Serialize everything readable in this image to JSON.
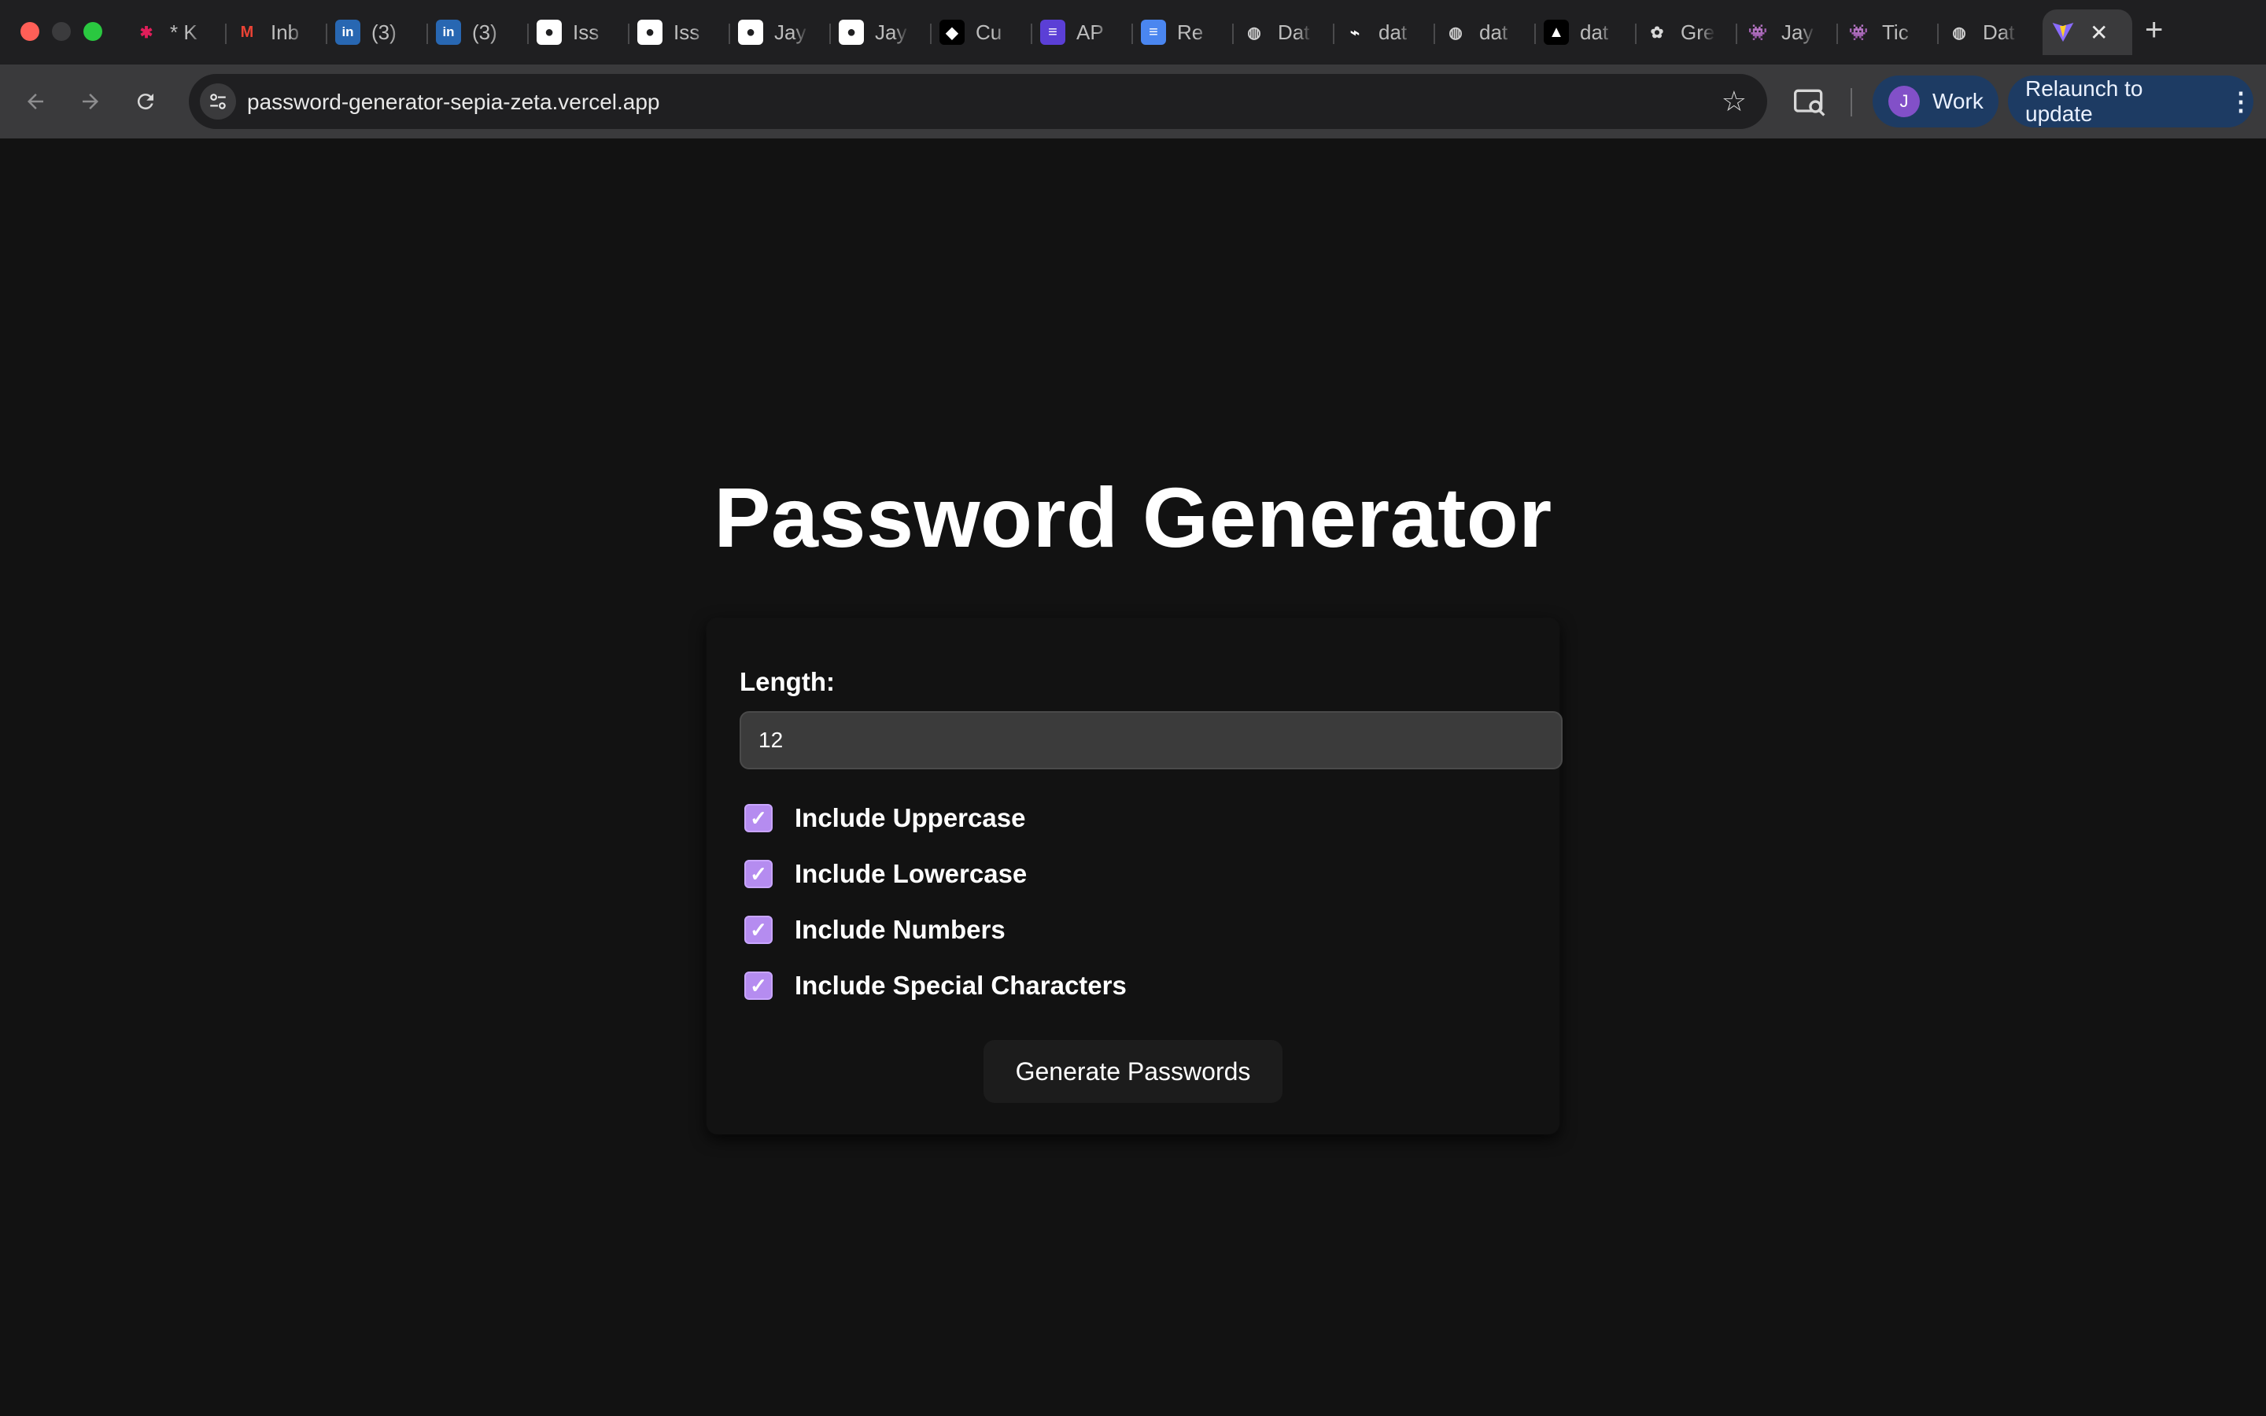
{
  "browser": {
    "tabs": [
      {
        "title": "* K",
        "icon": "slack-icon"
      },
      {
        "title": "Inb",
        "icon": "gmail-icon"
      },
      {
        "title": "(3)",
        "icon": "linkedin-icon"
      },
      {
        "title": "(3)",
        "icon": "linkedin-icon"
      },
      {
        "title": "Iss",
        "icon": "github-icon"
      },
      {
        "title": "Iss",
        "icon": "github-icon"
      },
      {
        "title": "Jay",
        "icon": "github-icon"
      },
      {
        "title": "Jay",
        "icon": "github-icon"
      },
      {
        "title": "Cu",
        "icon": "cursor-icon"
      },
      {
        "title": "AP",
        "icon": "list-icon"
      },
      {
        "title": "Re",
        "icon": "docs-icon"
      },
      {
        "title": "Dat",
        "icon": "globe-icon"
      },
      {
        "title": "dat",
        "icon": "link-icon"
      },
      {
        "title": "dat",
        "icon": "globe-icon"
      },
      {
        "title": "dat",
        "icon": "vercel-icon"
      },
      {
        "title": "Gre",
        "icon": "openai-icon"
      },
      {
        "title": "Jay",
        "icon": "alien-icon"
      },
      {
        "title": "Tic",
        "icon": "alien-icon"
      },
      {
        "title": "Dat",
        "icon": "globe-icon"
      }
    ],
    "active_tab": {
      "icon": "vite-icon",
      "close": "✕"
    },
    "new_tab": "+",
    "url": "password-generator-sepia-zeta.vercel.app",
    "profile": {
      "initial": "J",
      "name": "Work"
    },
    "relaunch_label": "Relaunch to update",
    "colors": {
      "chip_bg": "#1d3b63",
      "avatar": "#8250c8"
    }
  },
  "app": {
    "title": "Password Generator",
    "length_label": "Length:",
    "length_value": "12",
    "options": [
      {
        "label": "Include Uppercase",
        "checked": true
      },
      {
        "label": "Include Lowercase",
        "checked": true
      },
      {
        "label": "Include Numbers",
        "checked": true
      },
      {
        "label": "Include Special Characters",
        "checked": true
      }
    ],
    "checkmark": "✓",
    "generate_label": "Generate Passwords",
    "colors": {
      "background": "#121212",
      "checkbox": "#b58cf0",
      "input_bg": "#3b3b3b"
    }
  }
}
